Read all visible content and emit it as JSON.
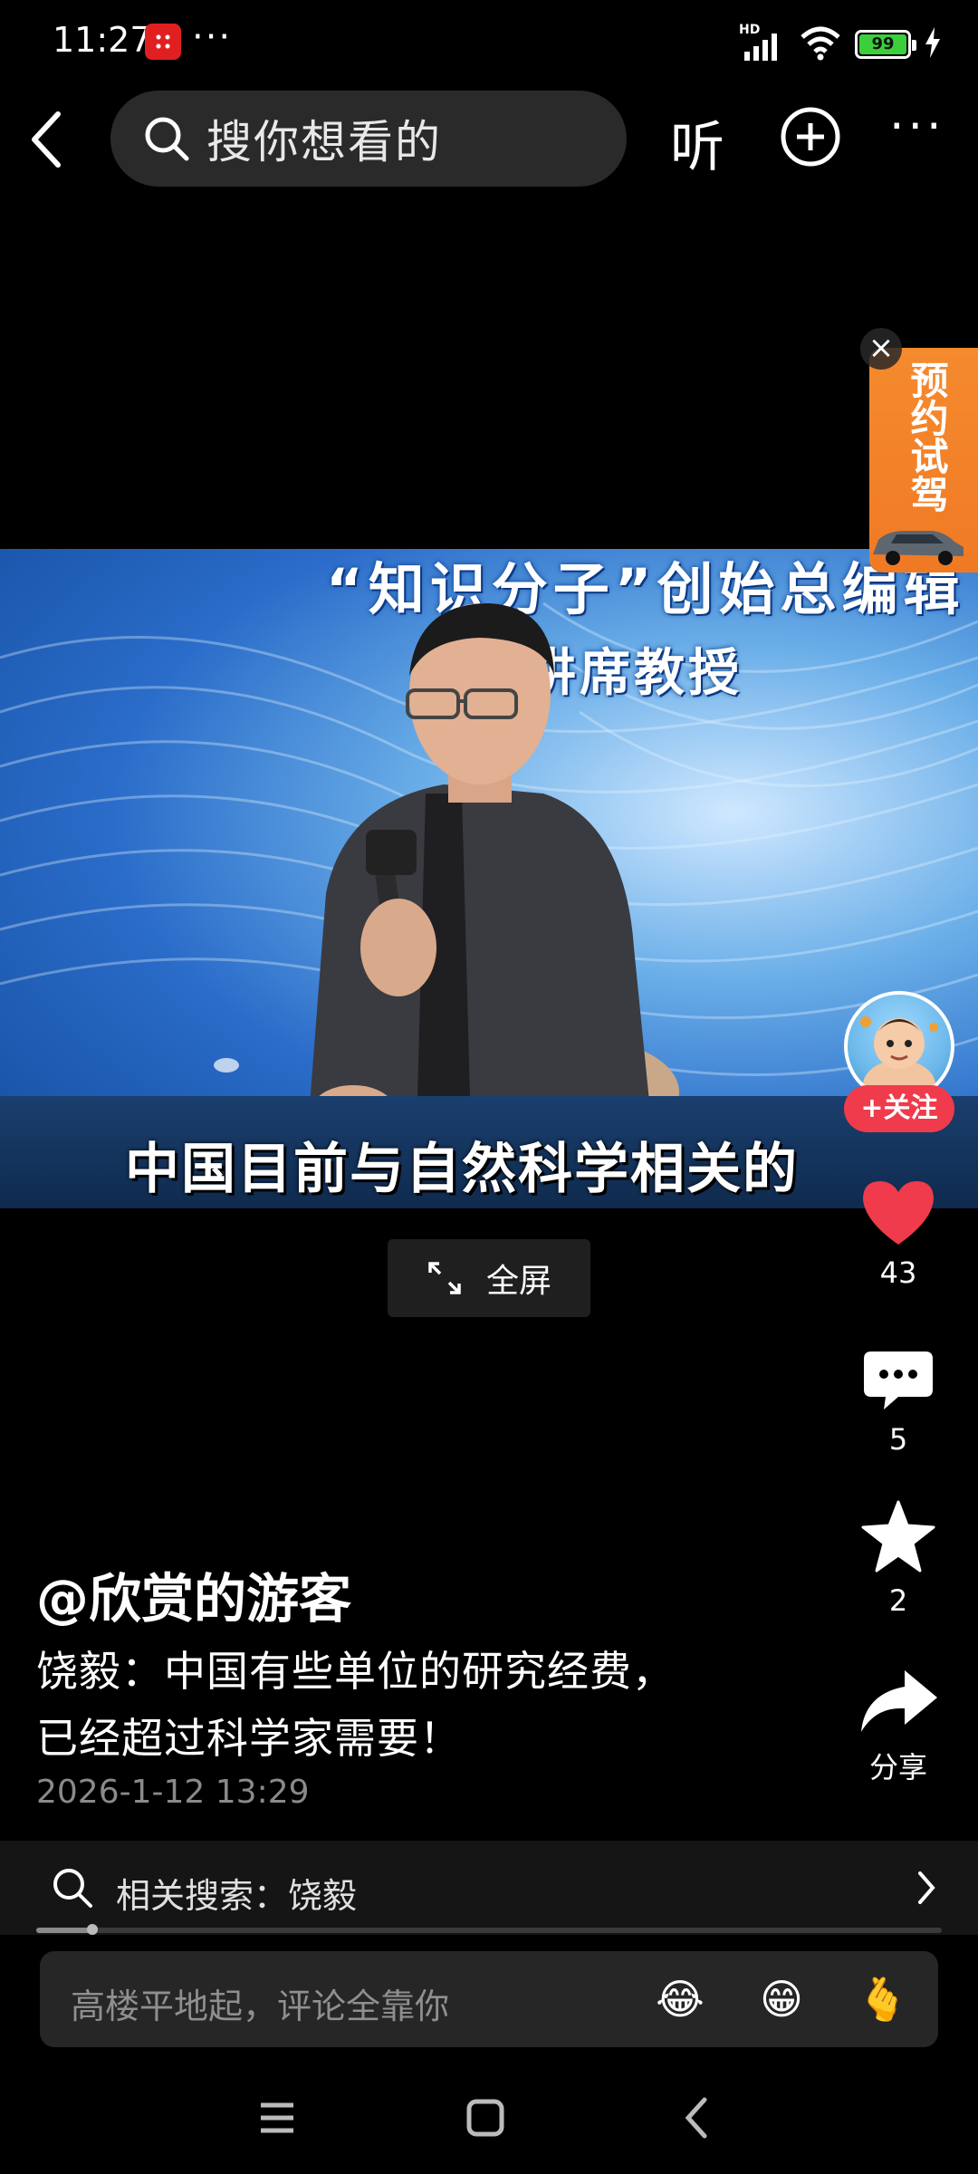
{
  "status_bar": {
    "time": "11:27",
    "overflow": "···",
    "network": "HD",
    "battery": "99"
  },
  "top_bar": {
    "search_placeholder": "搜你想看的",
    "listen_label": "听",
    "more_label": "···"
  },
  "ad": {
    "text": "预约试驾",
    "close": "×"
  },
  "video": {
    "banner_line1": "“知识分子”创始总编辑",
    "banner_line2": "大学讲席教授",
    "subtitle": "中国目前与自然科学相关的",
    "progress": 0.062
  },
  "fullscreen": {
    "label": "全屏"
  },
  "rail": {
    "follow_label": "+关注",
    "likes": "43",
    "comments": "5",
    "favorites": "2",
    "share_label": "分享",
    "like_color": "#ef3b4b"
  },
  "post": {
    "author": "@欣赏的游客",
    "desc_line1": "饶毅：中国有些单位的研究经费，",
    "desc_line2": "已经超过科学家需要！",
    "timestamp": "2026-1-12 13:29"
  },
  "related": {
    "label": "相关搜索：饶毅"
  },
  "comment": {
    "placeholder": "高楼平地起，评论全靠你",
    "emojis": [
      "😂",
      "😁",
      "🫰"
    ]
  }
}
